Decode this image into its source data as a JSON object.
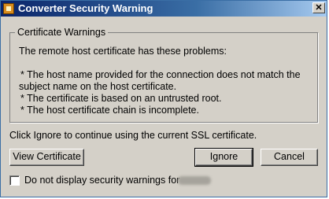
{
  "window": {
    "title": "Converter Security Warning",
    "close_label": "✕"
  },
  "group": {
    "label": "Certificate Warnings"
  },
  "message": {
    "intro": "The remote host certificate has these problems:",
    "p1a": "* The host name provided for the connection does not match the",
    "p1b": "subject name on the host certificate.",
    "p2": "* The certificate is based on an untrusted root.",
    "p3": "* The host certificate chain is incomplete."
  },
  "instruction": "Click Ignore to continue using the current SSL certificate.",
  "buttons": {
    "view_certificate": "View Certificate",
    "ignore": "Ignore",
    "cancel": "Cancel"
  },
  "checkbox": {
    "label": "Do not display security warnings for",
    "checked": false
  }
}
